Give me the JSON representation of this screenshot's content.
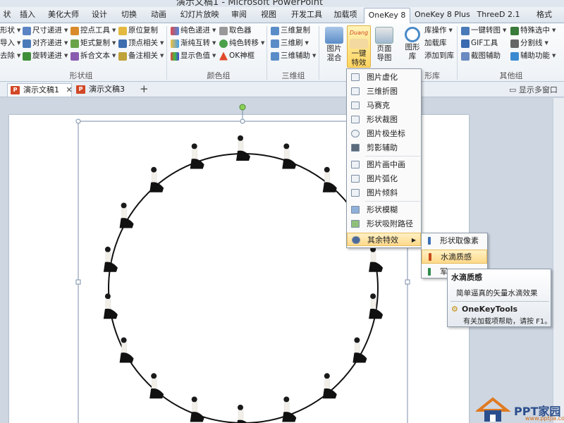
{
  "window": {
    "title": "演示文稿1 - Microsoft PowerPoint"
  },
  "tabs": [
    "状",
    "插入",
    "美化大师",
    "设计",
    "切换",
    "动画",
    "幻灯片放映",
    "审阅",
    "视图",
    "开发工具",
    "加载项",
    "OneKey 8",
    "OneKey 8 Plus",
    "ThreeD 2.1",
    "格式"
  ],
  "active_tab": "OneKey 8",
  "ribbon": {
    "shape_group": {
      "label": "形状组",
      "items": [
        "形状",
        "尺寸递进",
        "控点工具",
        "原位复制",
        "导入",
        "对齐递进",
        "矩式复制",
        "顶点相关",
        "去除",
        "旋转递进",
        "拆合文本",
        "备注相关"
      ]
    },
    "color_group": {
      "label": "颜色组",
      "items": [
        "纯色递进",
        "取色器",
        "渐纯互转",
        "纯色转移",
        "显示色值",
        "OK神框"
      ]
    },
    "threed_group": {
      "label": "三维组",
      "items": [
        "三维复制",
        "三维刷",
        "三维辅助"
      ]
    },
    "image_group": {
      "picture_mix": "图片\n混合",
      "one_click": "一键\n特效",
      "page_import": "页面\n导图",
      "one_click_badge": "Duang"
    },
    "library_group": {
      "label": "形库",
      "shape_lib": "图形\n库",
      "items": [
        "库操作",
        "加载库",
        "添加到库"
      ]
    },
    "other_group": {
      "label": "其他组",
      "items": [
        "一键转图",
        "特殊选中",
        "GIF工具",
        "分割线",
        "截图辅助",
        "辅助功能"
      ]
    }
  },
  "doc_tabs": [
    {
      "label": "演示文稿1",
      "active": true,
      "close": "✕"
    },
    {
      "label": "演示文稿3",
      "active": false
    }
  ],
  "doc_tab_add": "+",
  "multi_window": "显示多窗口",
  "dropdown": {
    "items": [
      {
        "label": "图片虚化"
      },
      {
        "label": "三维折图"
      },
      {
        "label": "马赛克"
      },
      {
        "label": "形状裁图"
      },
      {
        "label": "图片极坐标"
      },
      {
        "label": "剪影辅助"
      },
      {
        "label": "图片画中画"
      },
      {
        "label": "图片弧化"
      },
      {
        "label": "图片倾斜"
      },
      {
        "label": "形状模糊"
      },
      {
        "label": "形状吸附路径"
      },
      {
        "label": "其余特效"
      }
    ],
    "highlighted": "其余特效"
  },
  "submenu": {
    "items": [
      {
        "label": "形状取像素",
        "color": "#3d6fb6"
      },
      {
        "label": "水滴质感",
        "color": "#c84a1a"
      },
      {
        "label": "军",
        "color": "#2f8a4c"
      }
    ],
    "highlighted": "水滴质感"
  },
  "tooltip": {
    "title": "水滴质感",
    "description": "简单逼真的矢量水滴效果",
    "brand": "OneKeyTools",
    "help": "有关加载项帮助，请按 F1。"
  },
  "watermark": {
    "text": "PPT家园",
    "sub": "www.pptjia.com"
  },
  "colors": {
    "accent": "#d24726",
    "menu_highlight": "#ffd98a",
    "tab_border": "#9fb2c8"
  }
}
